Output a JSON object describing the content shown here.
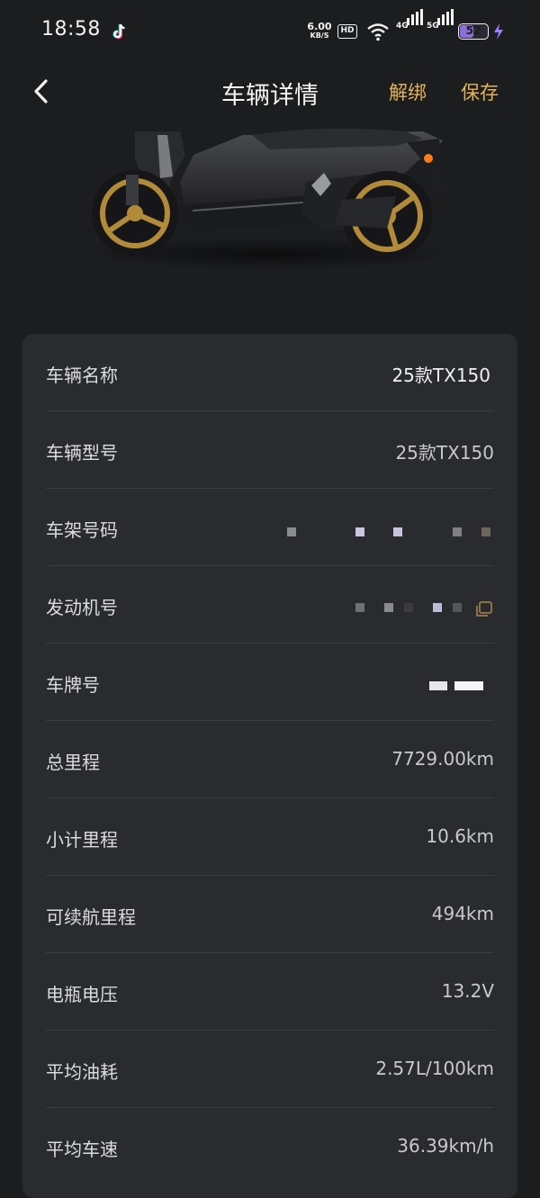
{
  "status_bar": {
    "time": "18:58",
    "net_speed_value": "6.00",
    "net_speed_unit": "KB/S",
    "hd_label": "HD",
    "signal_1_label": "4G",
    "signal_2_label": "5G",
    "battery_level": "52",
    "icons": [
      "tiktok-icon",
      "wifi-icon",
      "signal-icon",
      "battery-icon",
      "charging-icon"
    ]
  },
  "header": {
    "title": "车辆详情",
    "unbind_label": "解绑",
    "save_label": "保存",
    "accent_color": "#e3b35a"
  },
  "details": [
    {
      "label": "车辆名称",
      "value": "25款TX150",
      "kind": "editable"
    },
    {
      "label": "车辆型号",
      "value": "25款TX150",
      "kind": "text"
    },
    {
      "label": "车架号码",
      "value": "",
      "kind": "masked"
    },
    {
      "label": "发动机号",
      "value": "",
      "kind": "masked"
    },
    {
      "label": "车牌号",
      "value": "",
      "kind": "masked"
    },
    {
      "label": "总里程",
      "value": "7729.00km",
      "kind": "text"
    },
    {
      "label": "小计里程",
      "value": "10.6km",
      "kind": "text"
    },
    {
      "label": "可续航里程",
      "value": "494km",
      "kind": "text"
    },
    {
      "label": "电瓶电压",
      "value": "13.2V",
      "kind": "text"
    },
    {
      "label": "平均油耗",
      "value": "2.57L/100km",
      "kind": "text"
    },
    {
      "label": "平均车速",
      "value": "36.39km/h",
      "kind": "text"
    }
  ]
}
